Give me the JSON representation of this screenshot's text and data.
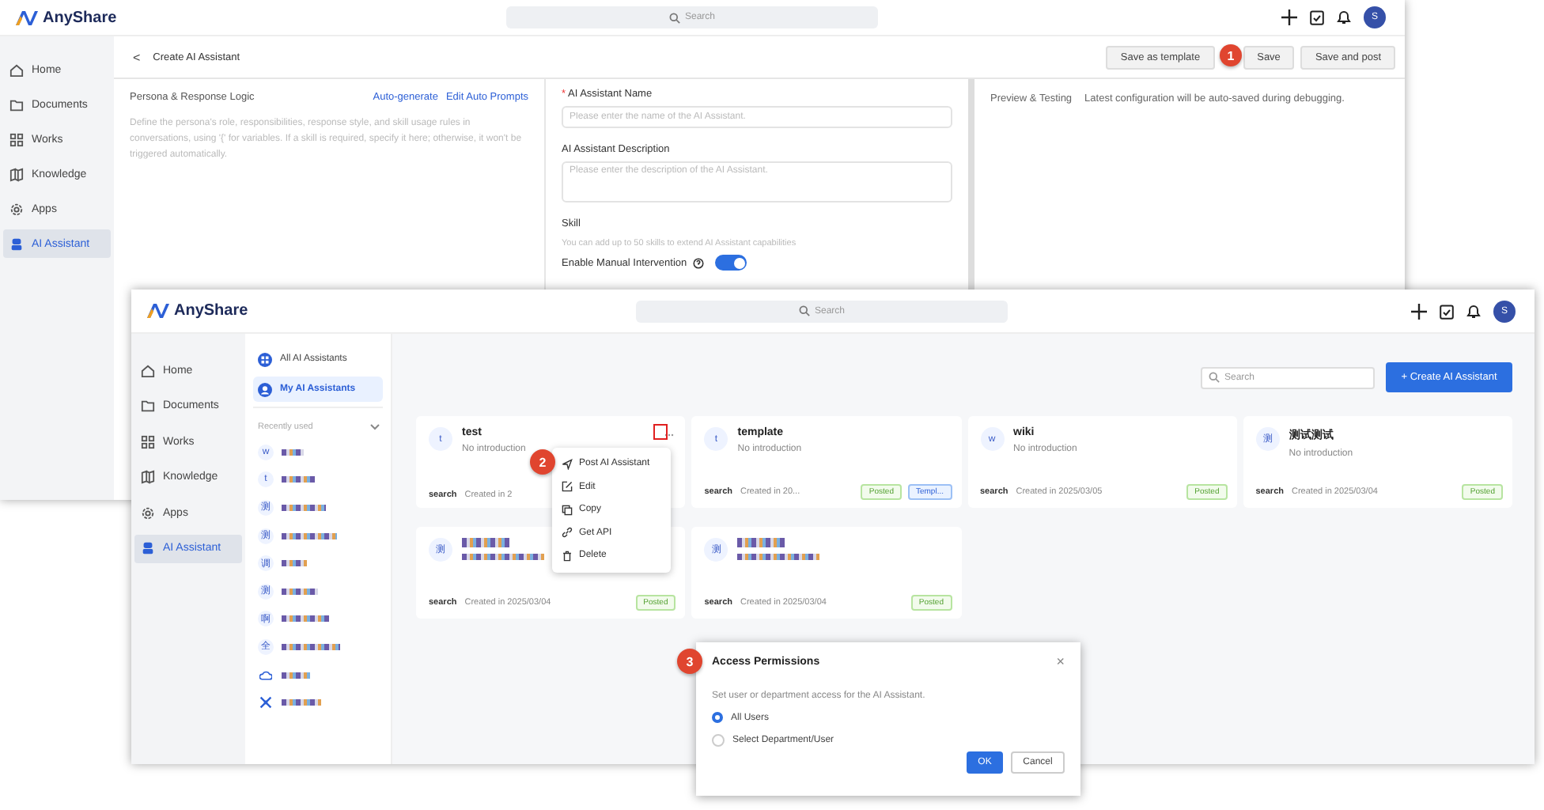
{
  "back_window": {
    "brand": "AnyShare",
    "search": {
      "placeholder": "Search"
    },
    "avatar": "S",
    "nav": [
      {
        "kind": "home",
        "label": "Home",
        "selected": false
      },
      {
        "kind": "folder",
        "label": "Documents",
        "selected": false
      },
      {
        "kind": "grid",
        "label": "Works",
        "selected": false
      },
      {
        "kind": "book",
        "label": "Knowledge",
        "selected": false
      },
      {
        "kind": "apps",
        "label": "Apps",
        "selected": false
      },
      {
        "kind": "bot",
        "label": "AI Assistant",
        "selected": true
      }
    ],
    "back_glyph": "<",
    "page_title": "Create AI Assistant",
    "buttons": [
      "Save as template",
      "Save",
      "Save and post"
    ],
    "persona": {
      "title": "Persona & Response Logic",
      "actions": [
        "Auto-generate",
        "Edit Auto Prompts"
      ],
      "hint": "Define the persona's role, responsibilities, response style, and skill usage rules in conversations, using '{' for variables. If a skill is required, specify it here; otherwise, it won't be triggered automatically."
    },
    "form": {
      "required_mark": "*",
      "name_label": "AI Assistant Name",
      "name_placeholder": "Please enter the name of the AI Assistant.",
      "desc_label": "AI Assistant Description",
      "desc_placeholder": "Please enter the description of the AI Assistant.",
      "skill_label": "Skill",
      "skill_hint": "You can add up to 50 skills to extend AI Assistant capabilities",
      "intervention_label": "Enable Manual Intervention",
      "intervention_on": true
    },
    "preview": {
      "title": "Preview & Testing",
      "note": "Latest configuration will be auto-saved during debugging."
    }
  },
  "front_window": {
    "brand": "AnyShare",
    "search": {
      "placeholder": "Search"
    },
    "avatar": "S",
    "nav": [
      {
        "kind": "home",
        "label": "Home",
        "selected": false
      },
      {
        "kind": "folder",
        "label": "Documents",
        "selected": false
      },
      {
        "kind": "grid",
        "label": "Works",
        "selected": false
      },
      {
        "kind": "book",
        "label": "Knowledge",
        "selected": false
      },
      {
        "kind": "apps",
        "label": "Apps",
        "selected": false
      },
      {
        "kind": "bot",
        "label": "AI Assistant",
        "selected": true
      }
    ],
    "tabs": [
      {
        "kind": "all",
        "label": "All AI Assistants",
        "selected": false
      },
      {
        "kind": "mine",
        "label": "My AI Assistants",
        "selected": true
      }
    ],
    "recent_title": "Recently used",
    "recent": [
      {
        "kind": "letter",
        "avatar": "w"
      },
      {
        "kind": "letter",
        "avatar": "t"
      },
      {
        "kind": "letter",
        "avatar": "测"
      },
      {
        "kind": "letter",
        "avatar": "测"
      },
      {
        "kind": "letter",
        "avatar": "调"
      },
      {
        "kind": "letter",
        "avatar": "测"
      },
      {
        "kind": "letter",
        "avatar": "啊"
      },
      {
        "kind": "letter",
        "avatar": "全"
      },
      {
        "kind": "cloud"
      },
      {
        "kind": "cross"
      }
    ],
    "list_search": {
      "placeholder": "Search"
    },
    "create_button": "+ Create AI Assistant",
    "cards": [
      {
        "kind": "text",
        "avatar": "t",
        "name": "test",
        "intro": "No introduction",
        "skill": "search",
        "created": "Created in 2",
        "more_button": true
      },
      {
        "kind": "text",
        "avatar": "t",
        "name": "template",
        "intro": "No introduction",
        "skill": "search",
        "created": "Created in 20...",
        "tags": [
          {
            "kind": "posted",
            "label": "Posted"
          },
          {
            "kind": "template",
            "label": "Templ..."
          }
        ]
      },
      {
        "kind": "text",
        "avatar": "w",
        "name": "wiki",
        "intro": "No introduction",
        "skill": "search",
        "created": "Created in 2025/03/05",
        "tags": [
          {
            "kind": "posted",
            "label": "Posted"
          }
        ]
      },
      {
        "kind": "text",
        "avatar": "测",
        "name": "测试测试",
        "intro": "No introduction",
        "skill": "search",
        "created": "Created in 2025/03/04",
        "tags": [
          {
            "kind": "posted",
            "label": "Posted"
          }
        ]
      },
      {
        "kind": "redacted",
        "avatar": "测",
        "skill": "search",
        "created": "Created in 2025/03/04",
        "tags": [
          {
            "kind": "posted",
            "label": "Posted"
          }
        ]
      },
      {
        "kind": "redacted",
        "avatar": "测",
        "skill": "search",
        "created": "Created in 2025/03/04",
        "tags": [
          {
            "kind": "posted",
            "label": "Posted"
          }
        ]
      }
    ],
    "menu": [
      {
        "kind": "send",
        "label": "Post AI Assistant"
      },
      {
        "kind": "edit",
        "label": "Edit"
      },
      {
        "kind": "copy",
        "label": "Copy"
      },
      {
        "kind": "link",
        "label": "Get API"
      },
      {
        "kind": "trash",
        "label": "Delete"
      }
    ]
  },
  "dialog": {
    "title": "Access Permissions",
    "close": "×",
    "text": "Set user or department access for the AI Assistant.",
    "options": [
      {
        "label": "All Users",
        "selected": true
      },
      {
        "label": "Select Department/User",
        "selected": false
      }
    ],
    "ok": "OK",
    "cancel": "Cancel"
  },
  "callouts": [
    "1",
    "2",
    "3"
  ]
}
